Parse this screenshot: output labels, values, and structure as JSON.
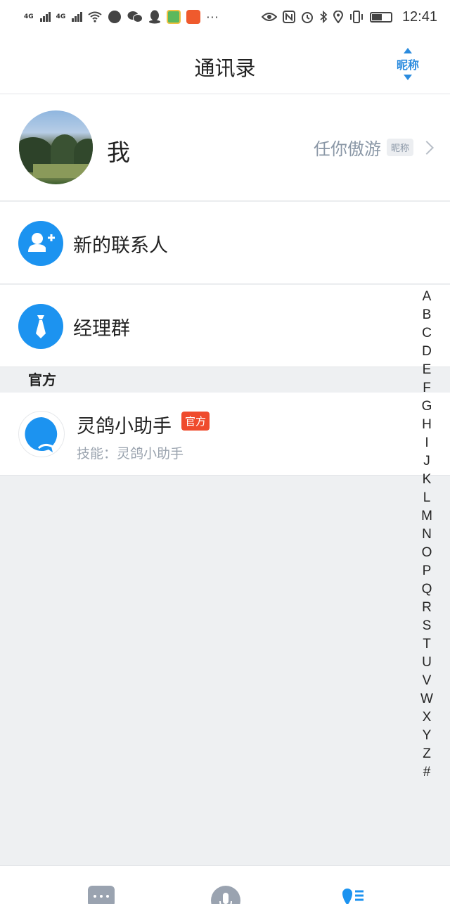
{
  "status_bar": {
    "time": "12:41",
    "network_1": "4G",
    "network_2": "4G",
    "icons_left": [
      "signal-icon",
      "signal-icon",
      "wifi-icon",
      "app-icon",
      "wechat-icon",
      "qq-icon",
      "app-green-icon",
      "app-orange-icon",
      "more-icon"
    ],
    "icons_right": [
      "eye-icon",
      "nfc-icon",
      "alarm-icon",
      "bluetooth-icon",
      "location-icon",
      "vibrate-icon",
      "battery-icon"
    ],
    "more": "···"
  },
  "header": {
    "title": "通讯录",
    "sort_label": "昵称"
  },
  "me": {
    "name": "我",
    "nickname": "任你傲游",
    "nickname_tag": "昵称"
  },
  "rows": {
    "new_contacts": "新的联系人",
    "manager_group": "经理群"
  },
  "section": {
    "official": "官方"
  },
  "assistant": {
    "name": "灵鸽小助手",
    "tag": "官方",
    "skill": "技能：灵鸽小助手"
  },
  "alpha_index": [
    "A",
    "B",
    "C",
    "D",
    "E",
    "F",
    "G",
    "H",
    "I",
    "J",
    "K",
    "L",
    "M",
    "N",
    "O",
    "P",
    "Q",
    "R",
    "S",
    "T",
    "U",
    "V",
    "W",
    "X",
    "Y",
    "Z",
    "#"
  ],
  "colors": {
    "accent": "#1c93f0",
    "sort_blue": "#2a8bde",
    "official_red": "#ef4b2d",
    "background": "#eef0f2"
  }
}
